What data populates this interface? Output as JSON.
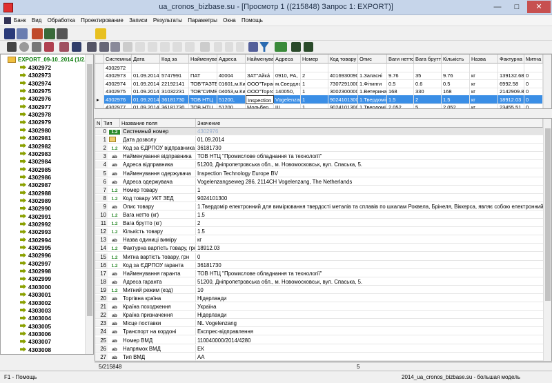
{
  "window": {
    "title": "ua_cronos_bizbase.su - [Просмотр 1 ((215848) Запрос 1: EXPORT)]"
  },
  "menu": [
    "Банк",
    "Вид",
    "Обработка",
    "Проектирование",
    "Записи",
    "Результаты",
    "Параметры",
    "Окна",
    "Помощь"
  ],
  "tree": {
    "root": "EXPORT_09-10_2014 (1/2...",
    "items": [
      "4302972",
      "4302973",
      "4302974",
      "4302975",
      "4302976",
      "4302977",
      "4302978",
      "4302979",
      "4302980",
      "4302981",
      "4302982",
      "4302983",
      "4302984",
      "4302985",
      "4302986",
      "4302987",
      "4302988",
      "4302989",
      "4302990",
      "4302991",
      "4302992",
      "4302993",
      "4302994",
      "4302995",
      "4302996",
      "4302997",
      "4302998",
      "4302999",
      "4303000",
      "4303001",
      "4303002",
      "4303003",
      "4303004",
      "4303005",
      "4303006",
      "4303007",
      "4303008"
    ]
  },
  "grid_top": {
    "columns": [
      "Системный",
      "Дата",
      "Код за",
      "Найменуван",
      "Адреса",
      "Найменуван",
      "Адреса",
      "Номер",
      "Код товару",
      "Опис",
      "Ваги нетто",
      "Вага брутто",
      "Кількість",
      "Назва",
      "Фактурна",
      "Митна"
    ],
    "rows": [
      [
        "4302972",
        "",
        "",
        "",
        "",
        "",
        "",
        "",
        "",
        "",
        "",
        "",
        "",
        "",
        "",
        ""
      ],
      [
        "4302973",
        "01.09.2014",
        "5747991",
        "ПАТ",
        "40004",
        "ЗАТ\"Айка́",
        "0910, РА,",
        "2",
        "4016930090",
        "1.Запасні",
        "9.76",
        "35",
        "9.76",
        "кг",
        "139132.68",
        "0"
      ],
      [
        "4302974",
        "01.09.2014",
        "22192141",
        "ТОВ\"ГАЗТЕ",
        "01601,м.Киї",
        "ООО\"Тирас",
        "м.Свердлов",
        "1",
        "7307291000",
        "1.Фітинги",
        "0.5",
        "0.6",
        "0.5",
        "кг",
        "6992.58",
        "0"
      ],
      [
        "4302975",
        "01.09.2014",
        "31032231",
        "ТОВ\"СИМЕ",
        "04053,м.Киї",
        "ООО\"Торго",
        "140050,",
        "1",
        "3002300000",
        "1.Ветеринар",
        "168",
        "330",
        "168",
        "кг",
        "2142909.88",
        "0"
      ],
      [
        "4302976",
        "01.09.2014",
        "36181730",
        "ТОВ НТЦ",
        "51200,",
        "Inspection",
        "Vogelenzang",
        "1",
        "9024101300",
        "1.Твердоміr",
        "1.5",
        "2",
        "1.5",
        "кг",
        "18912.03",
        "0"
      ],
      [
        "4302977",
        "01.09.2014",
        "36181730",
        "ТОВ НТЦ",
        "51200,",
        "Мольбер",
        "Ш.",
        "1",
        "9024101300",
        "1.Твердомі",
        "2.052",
        "5",
        "2.052",
        "кг",
        "23455.51",
        "0"
      ]
    ],
    "selected_row": 4,
    "editor_value": "Inspection"
  },
  "grid_detail": {
    "columns": [
      "N",
      "Тип",
      "Название поля",
      "Значение"
    ],
    "rows": [
      {
        "n": "0",
        "type": "1.2",
        "field": "Системный номер",
        "value": "4302976"
      },
      {
        "n": "1",
        "type": "date",
        "field": "Дата дозволу",
        "value": "01.09.2014"
      },
      {
        "n": "2",
        "type": "1.2",
        "field": "Код за ЄДРПОУ відправника",
        "value": "36181730"
      },
      {
        "n": "3",
        "type": "ab",
        "field": "Найменування відправника",
        "value": "ТОВ НТЦ \"Промислове обладнання та технології\""
      },
      {
        "n": "4",
        "type": "ab",
        "field": "Адреса відправника",
        "value": "51200, Дніпропетровська обл., м. Новомосковськ, вул. Спаська, 5."
      },
      {
        "n": "5",
        "type": "ab",
        "field": "Найменування одержувача",
        "value": "Inspection Technology Europe BV"
      },
      {
        "n": "6",
        "type": "ab",
        "field": "Адреса одержувача",
        "value": "Vogelenzangseweg 286, 2114CH Vogelenzang, The Netherlands"
      },
      {
        "n": "7",
        "type": "1.2",
        "field": "Номер товару",
        "value": "1"
      },
      {
        "n": "8",
        "type": "1.2",
        "field": "Код товару УКТ ЗЕД",
        "value": "9024101300"
      },
      {
        "n": "9",
        "type": "ab",
        "field": "Опис товару",
        "value": "1.Твердомір електронний для вимірювання твердості металів та сплавів по шкалам Роквела, Брінеля, Віккерса, являє собою електронний,"
      },
      {
        "n": "10",
        "type": "1.2",
        "field": "Вага нетто (кг)",
        "value": "1.5"
      },
      {
        "n": "11",
        "type": "1.2",
        "field": "Вага брутто (кг)",
        "value": "2"
      },
      {
        "n": "12",
        "type": "1.2",
        "field": "Кількість товару",
        "value": "1.5"
      },
      {
        "n": "13",
        "type": "ab",
        "field": "Назва одиниці виміру",
        "value": "кг"
      },
      {
        "n": "14",
        "type": "1.2",
        "field": "Фактурна вартість товару, грн",
        "value": "18912.03"
      },
      {
        "n": "15",
        "type": "1.2",
        "field": "Митна вартість товару, грн",
        "value": "0"
      },
      {
        "n": "16",
        "type": "1.2",
        "field": "Код за ЄДРПОУ гаранта",
        "value": "36181730"
      },
      {
        "n": "17",
        "type": "ab",
        "field": "Найменування гаранта",
        "value": "ТОВ НТЦ \"Промислове обладнання та технології\""
      },
      {
        "n": "18",
        "type": "ab",
        "field": "Адреса гаранта",
        "value": "51200, Дніпропетровська обл., м. Новомосковськ, вул. Спаська, 5."
      },
      {
        "n": "19",
        "type": "1.2",
        "field": "Митний режим (код)",
        "value": "10"
      },
      {
        "n": "20",
        "type": "ab",
        "field": "Торгівна країна",
        "value": "Нідерланди"
      },
      {
        "n": "21",
        "type": "ab",
        "field": "Країна походження",
        "value": "Україна"
      },
      {
        "n": "22",
        "type": "ab",
        "field": "Країна призначення",
        "value": "Нідерланди"
      },
      {
        "n": "23",
        "type": "ab",
        "field": "Місце поставки",
        "value": "NL Vogelenzang"
      },
      {
        "n": "24",
        "type": "ab",
        "field": "Транспорт на кордоні",
        "value": "Експрес-відправлення"
      },
      {
        "n": "25",
        "type": "ab",
        "field": "Номер ВМД",
        "value": "110040000/2014/4280"
      },
      {
        "n": "26",
        "type": "ab",
        "field": "Напрямок ВМД",
        "value": "ЕК"
      },
      {
        "n": "27",
        "type": "ab",
        "field": "Тип ВМД",
        "value": "АА"
      }
    ]
  },
  "status": {
    "record": "5/215848",
    "mid_value": "5",
    "help": "F1 - Помощь",
    "model": "2014_ua_cronos_bizbase.su - большая модель"
  },
  "colors": {
    "selection": "#3a8ee6",
    "tree_root": "#0a7a0a",
    "type_num": "#2b8a2b",
    "type_text": "#1a1a1a"
  }
}
